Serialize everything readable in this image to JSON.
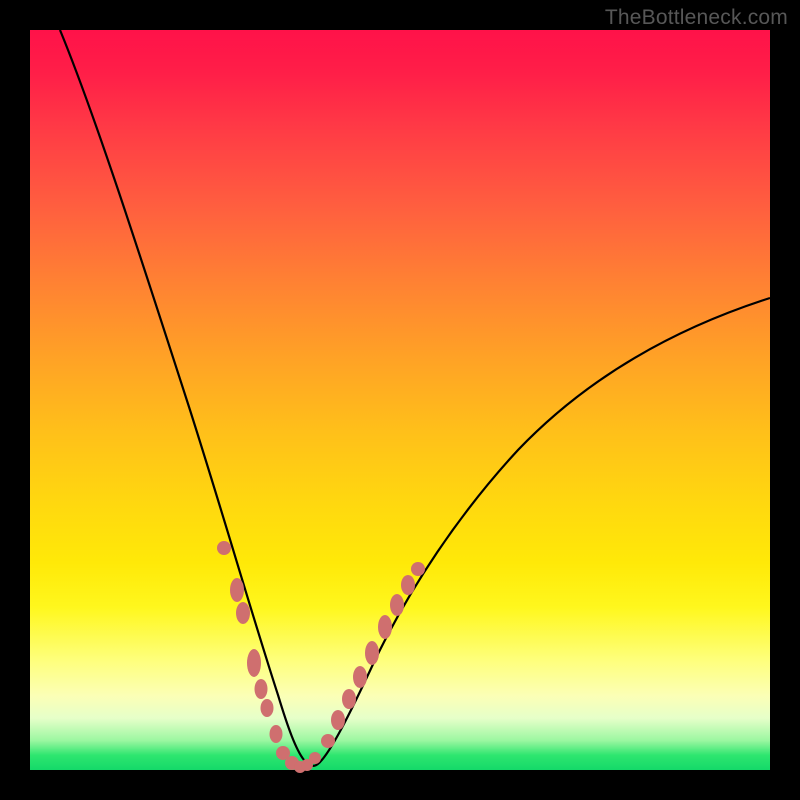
{
  "watermark": "TheBottleneck.com",
  "chart_data": {
    "type": "line",
    "title": "",
    "xlabel": "",
    "ylabel": "",
    "xlim": [
      0,
      100
    ],
    "ylim": [
      0,
      100
    ],
    "grid": false,
    "legend": false,
    "series": [
      {
        "name": "bottleneck-curve",
        "x": [
          4,
          8,
          12,
          16,
          20,
          23,
          26,
          28,
          30,
          32,
          33.5,
          35,
          36.5,
          38,
          40,
          43,
          47,
          53,
          60,
          68,
          77,
          87,
          100
        ],
        "y": [
          100,
          88,
          76,
          64,
          52,
          41,
          31,
          23,
          15,
          8,
          4,
          1.5,
          0.5,
          1,
          4,
          10,
          18,
          28,
          37,
          45,
          52,
          58,
          64
        ],
        "color": "#000000",
        "stroke_width": 2
      }
    ],
    "markers": [
      {
        "name": "left-branch-dots",
        "color": "#cf6f6f",
        "points": [
          {
            "x": 26.2,
            "y": 30
          },
          {
            "x": 27.8,
            "y": 24
          },
          {
            "x": 28.6,
            "y": 21
          },
          {
            "x": 30.2,
            "y": 14.5
          },
          {
            "x": 31.0,
            "y": 11
          },
          {
            "x": 31.8,
            "y": 8.5
          },
          {
            "x": 33.0,
            "y": 5
          },
          {
            "x": 34.0,
            "y": 2.5
          },
          {
            "x": 35.2,
            "y": 1
          },
          {
            "x": 36.2,
            "y": 0.5
          },
          {
            "x": 37.2,
            "y": 0.8
          }
        ]
      },
      {
        "name": "right-branch-dots",
        "color": "#cf6f6f",
        "points": [
          {
            "x": 38.4,
            "y": 1.8
          },
          {
            "x": 40.0,
            "y": 4.2
          },
          {
            "x": 41.4,
            "y": 7.0
          },
          {
            "x": 42.8,
            "y": 9.8
          },
          {
            "x": 44.2,
            "y": 12.8
          },
          {
            "x": 45.8,
            "y": 16.0
          },
          {
            "x": 47.6,
            "y": 19.5
          },
          {
            "x": 49.2,
            "y": 22.5
          },
          {
            "x": 50.8,
            "y": 25.3
          },
          {
            "x": 52.2,
            "y": 27.5
          }
        ]
      }
    ]
  }
}
